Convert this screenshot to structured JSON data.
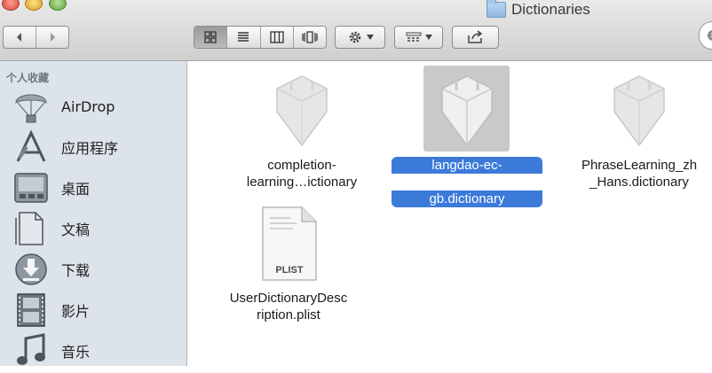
{
  "window": {
    "title": "Dictionaries"
  },
  "toolbar": {
    "back_icon": "chevron-left-icon",
    "forward_icon": "chevron-right-icon",
    "view_modes": [
      "icon-view-icon",
      "list-view-icon",
      "column-view-icon",
      "coverflow-view-icon"
    ],
    "active_view": "icon-view-icon",
    "action_icon": "gear-icon",
    "arrange_icon": "arrange-grid-icon",
    "share_icon": "share-icon"
  },
  "sidebar": {
    "heading": "个人收藏",
    "items": [
      {
        "label": "AirDrop",
        "icon": "airdrop-icon"
      },
      {
        "label": "应用程序",
        "icon": "applications-icon"
      },
      {
        "label": "桌面",
        "icon": "desktop-icon"
      },
      {
        "label": "文稿",
        "icon": "documents-icon"
      },
      {
        "label": "下载",
        "icon": "downloads-icon"
      },
      {
        "label": "影片",
        "icon": "movies-icon"
      },
      {
        "label": "音乐",
        "icon": "music-icon"
      }
    ]
  },
  "files": [
    {
      "line1": "completion-",
      "line2": "learning…ictionary",
      "icon": "dictionary-bundle-icon",
      "selected": false
    },
    {
      "line1": "langdao-ec-",
      "line2": "gb.dictionary",
      "icon": "dictionary-bundle-icon",
      "selected": true
    },
    {
      "line1": "PhraseLearning_zh",
      "line2": "_Hans.dictionary",
      "icon": "dictionary-bundle-icon",
      "selected": false
    },
    {
      "line1": "UserDictionaryDesc",
      "line2": "ription.plist",
      "icon": "plist-file-icon",
      "badge": "PLIST",
      "selected": false
    }
  ],
  "colors": {
    "selection": "#3b7ad9",
    "sidebar_bg": "#dde3ea"
  }
}
